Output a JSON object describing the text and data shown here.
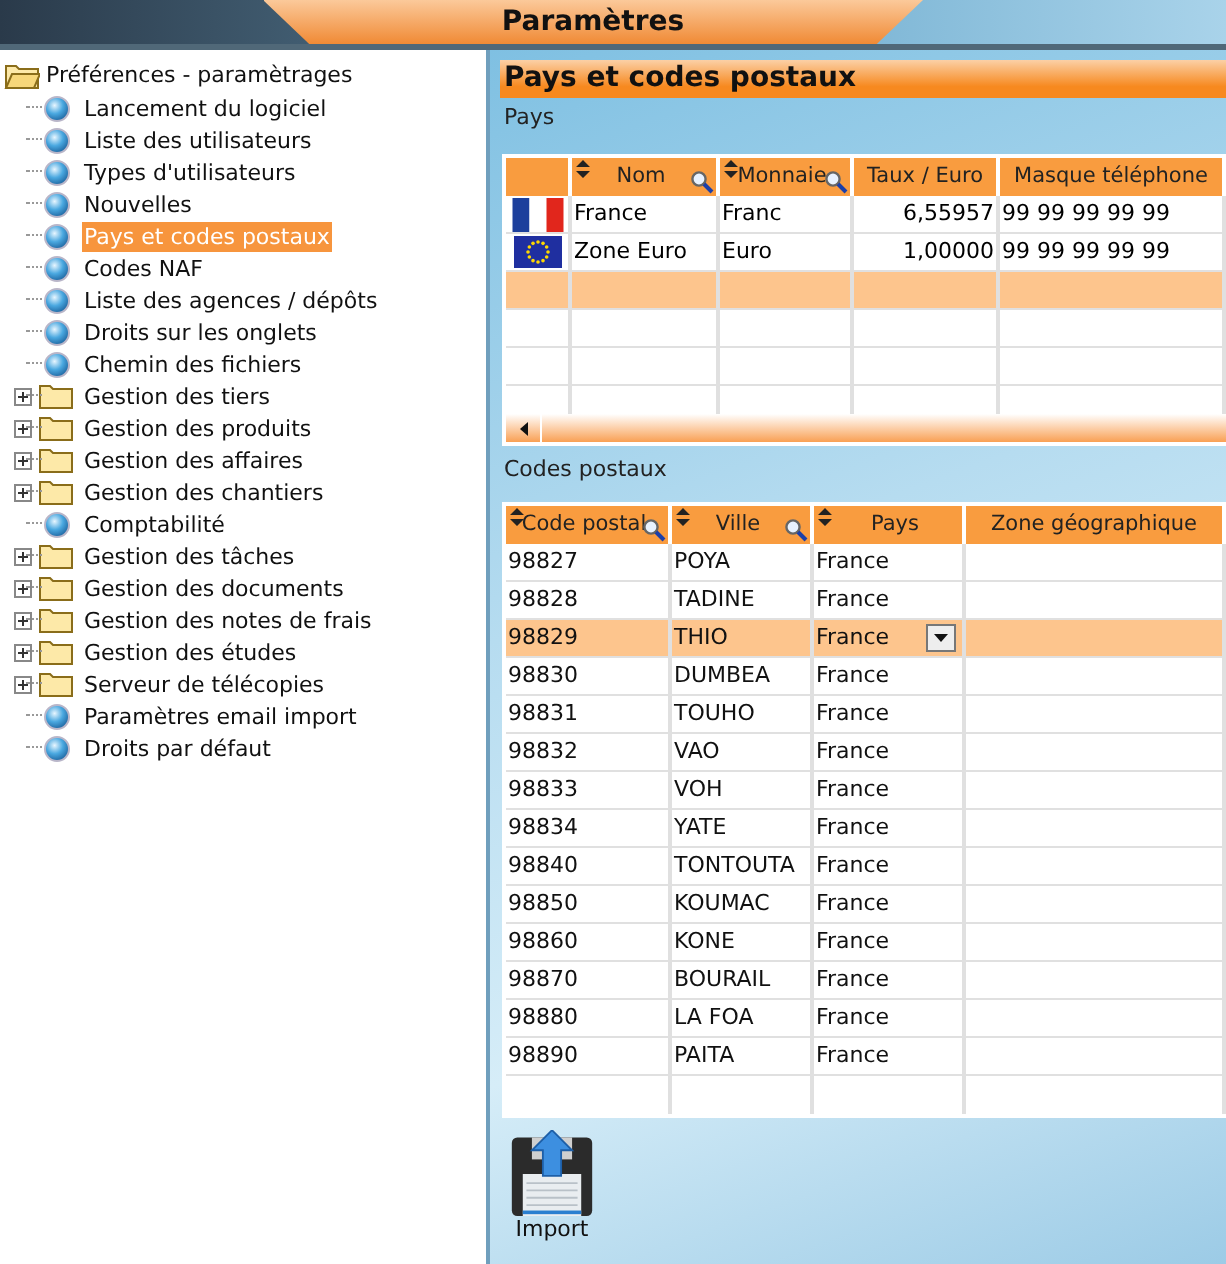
{
  "window": {
    "title": "Paramètres"
  },
  "tree": {
    "label": "Préférences - paramètrages",
    "expanded": true,
    "children": [
      {
        "label": "Lancement du logiciel",
        "kind": "leaf",
        "selected": false
      },
      {
        "label": "Liste des utilisateurs",
        "kind": "leaf",
        "selected": false
      },
      {
        "label": "Types d'utilisateurs",
        "kind": "leaf",
        "selected": false
      },
      {
        "label": "Nouvelles",
        "kind": "leaf",
        "selected": false
      },
      {
        "label": "Pays et codes postaux",
        "kind": "leaf",
        "selected": true
      },
      {
        "label": "Codes NAF",
        "kind": "leaf",
        "selected": false
      },
      {
        "label": "Liste des agences / dépôts",
        "kind": "leaf",
        "selected": false
      },
      {
        "label": "Droits sur les onglets",
        "kind": "leaf",
        "selected": false
      },
      {
        "label": "Chemin des fichiers",
        "kind": "leaf",
        "selected": false
      },
      {
        "label": "Gestion des tiers",
        "kind": "folder",
        "expanded": false,
        "selected": false
      },
      {
        "label": "Gestion des produits",
        "kind": "folder",
        "expanded": false,
        "selected": false
      },
      {
        "label": "Gestion des affaires",
        "kind": "folder",
        "expanded": false,
        "selected": false
      },
      {
        "label": "Gestion des chantiers",
        "kind": "folder",
        "expanded": false,
        "selected": false
      },
      {
        "label": "Comptabilité",
        "kind": "leaf",
        "selected": false
      },
      {
        "label": "Gestion des tâches",
        "kind": "folder",
        "expanded": false,
        "selected": false
      },
      {
        "label": "Gestion des documents",
        "kind": "folder",
        "expanded": false,
        "selected": false
      },
      {
        "label": "Gestion des notes de frais",
        "kind": "folder",
        "expanded": false,
        "selected": false
      },
      {
        "label": "Gestion des études",
        "kind": "folder",
        "expanded": false,
        "selected": false
      },
      {
        "label": "Serveur de télécopies",
        "kind": "folder",
        "expanded": false,
        "selected": false
      },
      {
        "label": "Paramètres email import",
        "kind": "leaf",
        "selected": false
      },
      {
        "label": "Droits par défaut",
        "kind": "leaf",
        "selected": false
      }
    ]
  },
  "panel": {
    "title": "Pays et codes postaux"
  },
  "countries": {
    "label": "Pays",
    "columns": [
      {
        "sortable": false,
        "searchable": false
      },
      {
        "label": "Nom",
        "sortable": true,
        "searchable": true
      },
      {
        "label": "Monnaie",
        "sortable": true,
        "searchable": true
      },
      {
        "label": "Taux / Euro",
        "sortable": false,
        "searchable": false
      },
      {
        "label": "Masque téléphone",
        "sortable": false,
        "searchable": false
      }
    ],
    "rows": [
      {
        "kind": "france",
        "name": "France",
        "currency": "Franc",
        "rate": "6,55957",
        "phone_mask": "99 99 99 99 99"
      },
      {
        "kind": "eu",
        "name": "Zone Euro",
        "currency": "Euro",
        "rate": "1,00000",
        "phone_mask": "99 99 99 99 99"
      }
    ],
    "blank_rows": [
      {
        "selected": true
      },
      {
        "selected": false
      },
      {
        "selected": false
      },
      {
        "selected": false
      }
    ]
  },
  "postal_codes": {
    "label": "Codes postaux",
    "columns": [
      {
        "label": "Code postal",
        "sortable": true,
        "searchable": true
      },
      {
        "label": "Ville",
        "sortable": true,
        "searchable": true
      },
      {
        "label": "Pays",
        "sortable": true,
        "searchable": false
      },
      {
        "label": "Zone géographique",
        "sortable": false,
        "searchable": false
      }
    ],
    "rows": [
      {
        "code": "98827",
        "city": "POYA",
        "country": "France",
        "selected": false
      },
      {
        "code": "98828",
        "city": "TADINE",
        "country": "France",
        "selected": false
      },
      {
        "code": "98829",
        "city": "THIO",
        "country": "France",
        "selected": true
      },
      {
        "code": "98830",
        "city": "DUMBEA",
        "country": "France",
        "selected": false
      },
      {
        "code": "98831",
        "city": "TOUHO",
        "country": "France",
        "selected": false
      },
      {
        "code": "98832",
        "city": "VAO",
        "country": "France",
        "selected": false
      },
      {
        "code": "98833",
        "city": "VOH",
        "country": "France",
        "selected": false
      },
      {
        "code": "98834",
        "city": "YATE",
        "country": "France",
        "selected": false
      },
      {
        "code": "98840",
        "city": "TONTOUTA",
        "country": "France",
        "selected": false
      },
      {
        "code": "98850",
        "city": "KOUMAC",
        "country": "France",
        "selected": false
      },
      {
        "code": "98860",
        "city": "KONE",
        "country": "France",
        "selected": false
      },
      {
        "code": "98870",
        "city": "BOURAIL",
        "country": "France",
        "selected": false
      },
      {
        "code": "98880",
        "city": "LA FOA",
        "country": "France",
        "selected": false
      },
      {
        "code": "98890",
        "city": "PAITA",
        "country": "France",
        "selected": false
      }
    ],
    "blank_rows": [
      {
        "selected": false
      }
    ]
  },
  "import_button": {
    "label": "Import"
  }
}
